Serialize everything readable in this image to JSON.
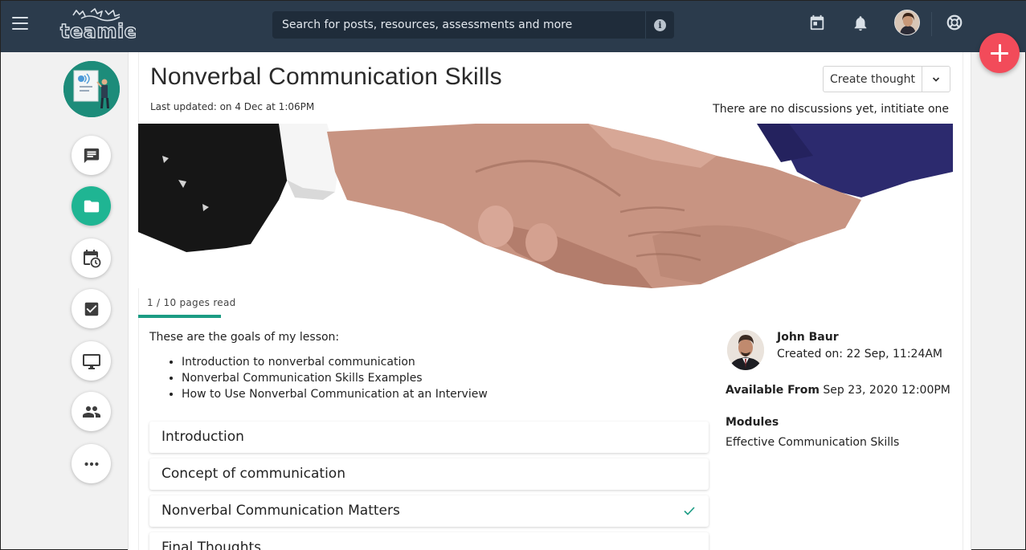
{
  "header": {
    "brand": "teamie",
    "search_placeholder": "Search for posts, resources, assessments and more",
    "icons": [
      "menu-icon",
      "info-icon",
      "calendar-icon",
      "bell-icon",
      "avatar",
      "help-lifebuoy-icon"
    ]
  },
  "fab": {
    "icon": "plus-icon",
    "color": "#f24b5a"
  },
  "rail": {
    "items": [
      "discussion-icon",
      "folder-icon",
      "calendar-clock-icon",
      "checkbox-icon",
      "monitor-icon",
      "people-icon",
      "more-icon"
    ],
    "active": "folder-icon",
    "accent": "#1fb593"
  },
  "lesson": {
    "title": "Nonverbal Communication Skills",
    "last_updated": "Last updated: on 4 Dec at 1:06PM",
    "create_thought": "Create thought",
    "no_discussions": "There are no discussions yet, intitiate one",
    "progress_text": "1 / 10 pages read",
    "pages_read": 1,
    "pages_total": 10,
    "goals_intro": "These are the goals of my lesson:",
    "goals": [
      "Introduction to nonverbal communication",
      "Nonverbal Communication Skills Examples",
      "How to Use Nonverbal Communication at an Interview"
    ],
    "sections": [
      {
        "label": "Introduction",
        "done": false
      },
      {
        "label": "Concept of communication",
        "done": false
      },
      {
        "label": "Nonverbal Communication Matters",
        "done": true
      },
      {
        "label": "Final Thoughts",
        "done": false
      }
    ]
  },
  "details": {
    "author_name": "John Baur",
    "created_on": "Created on: 22 Sep, 11:24AM",
    "available_label": "Available From",
    "available_value": "Sep 23, 2020 12:00PM",
    "modules_label": "Modules",
    "modules_value": "Effective Communication Skills"
  },
  "colors": {
    "topbar": "#2b3b4c",
    "progress": "#1c9c84",
    "check": "#1c9c84"
  }
}
